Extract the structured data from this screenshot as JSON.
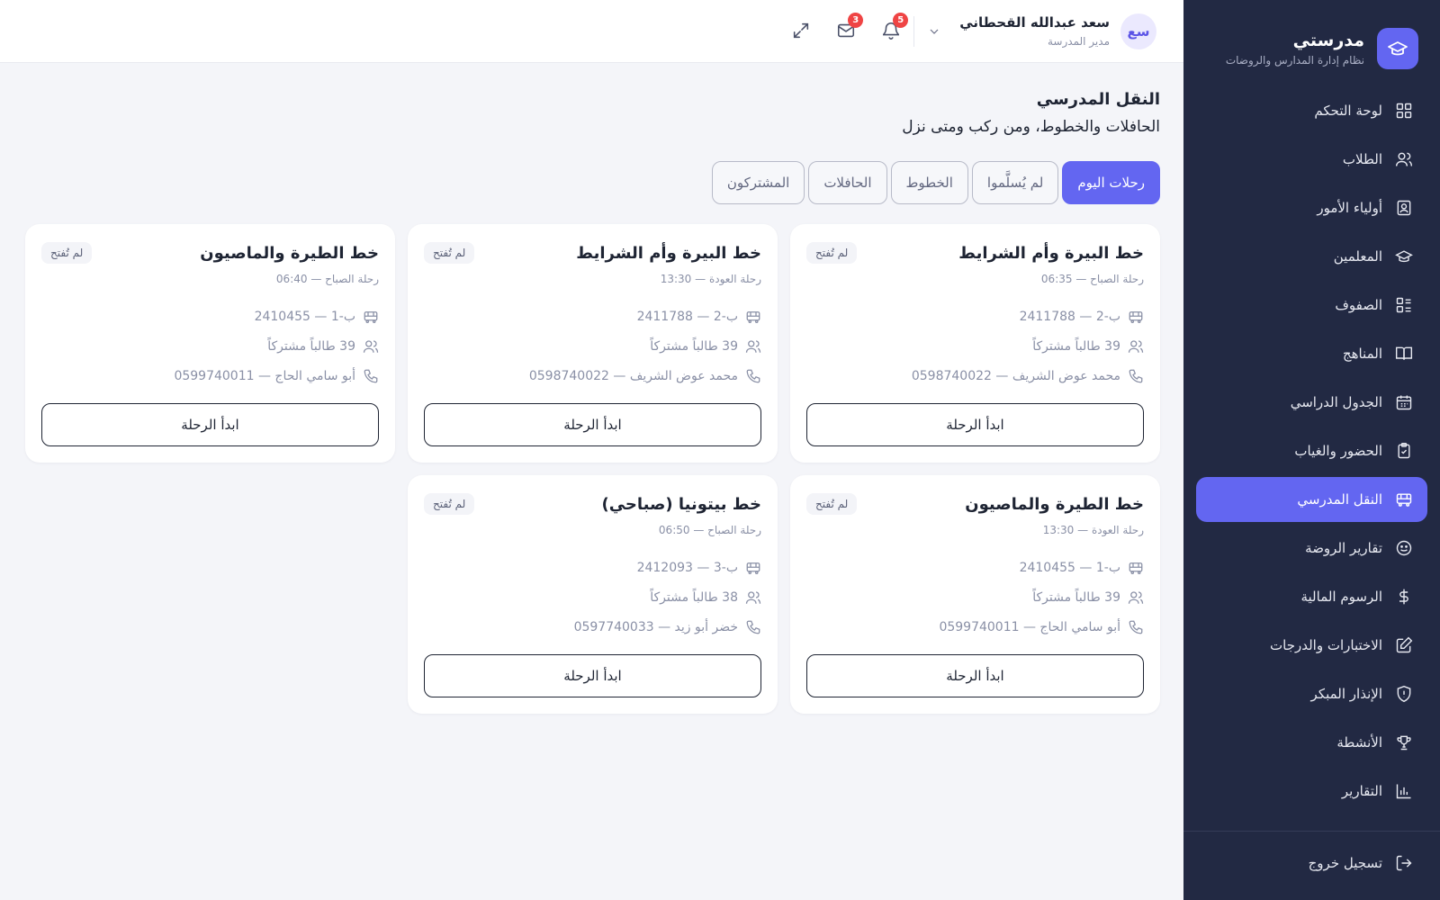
{
  "brand": {
    "name": "مدرستي",
    "subtitle": "نظام إدارة المدارس والروضات"
  },
  "sidebar": {
    "items": [
      {
        "label": "لوحة التحكم",
        "icon": "dashboard-icon"
      },
      {
        "label": "الطلاب",
        "icon": "users-icon"
      },
      {
        "label": "أولياء الأمور",
        "icon": "contact-icon"
      },
      {
        "label": "المعلمين",
        "icon": "graduation-cap-icon"
      },
      {
        "label": "الصفوف",
        "icon": "list-icon"
      },
      {
        "label": "المناهج",
        "icon": "book-icon"
      },
      {
        "label": "الجدول الدراسي",
        "icon": "calendar-icon"
      },
      {
        "label": "الحضور والغياب",
        "icon": "clipboard-check-icon"
      },
      {
        "label": "النقل المدرسي",
        "icon": "bus-icon",
        "active": true
      },
      {
        "label": "تقارير الروضة",
        "icon": "smile-icon"
      },
      {
        "label": "الرسوم المالية",
        "icon": "dollar-icon"
      },
      {
        "label": "الاختبارات والدرجات",
        "icon": "edit-icon"
      },
      {
        "label": "الإنذار المبكر",
        "icon": "shield-icon"
      },
      {
        "label": "الأنشطة",
        "icon": "trophy-icon"
      },
      {
        "label": "التقارير",
        "icon": "bar-chart-icon"
      }
    ],
    "logout": "تسجيل خروج"
  },
  "topbar": {
    "messages_badge": "3",
    "notifications_badge": "5",
    "user": {
      "name": "سعد عبدالله القحطاني",
      "role": "مدير المدرسة",
      "initials": "سع"
    }
  },
  "page": {
    "title": "النقل المدرسي",
    "subtitle": "الحافلات والخطوط، ومن ركب ومتى نزل"
  },
  "tabs": [
    "رحلات اليوم",
    "لم يُسلَّموا",
    "الخطوط",
    "الحافلات",
    "المشتركون"
  ],
  "trips": [
    {
      "title": "خط البيرة وأم الشرايط",
      "status": "لم تُفتح",
      "time": "رحلة الصباح — 06:35",
      "bus": "ب-2 — 2411788",
      "students": "39 طالباً مشتركاً",
      "driver": "محمد عوض الشريف — 0598740022",
      "action": "ابدأ الرحلة"
    },
    {
      "title": "خط البيرة وأم الشرايط",
      "status": "لم تُفتح",
      "time": "رحلة العودة — 13:30",
      "bus": "ب-2 — 2411788",
      "students": "39 طالباً مشتركاً",
      "driver": "محمد عوض الشريف — 0598740022",
      "action": "ابدأ الرحلة"
    },
    {
      "title": "خط الطيرة والماصيون",
      "status": "لم تُفتح",
      "time": "رحلة الصباح — 06:40",
      "bus": "ب-1 — 2410455",
      "students": "39 طالباً مشتركاً",
      "driver": "أبو سامي الحاج — 0599740011",
      "action": "ابدأ الرحلة"
    },
    {
      "title": "خط الطيرة والماصيون",
      "status": "لم تُفتح",
      "time": "رحلة العودة — 13:30",
      "bus": "ب-1 — 2410455",
      "students": "39 طالباً مشتركاً",
      "driver": "أبو سامي الحاج — 0599740011",
      "action": "ابدأ الرحلة"
    },
    {
      "title": "خط بيتونيا (صباحي)",
      "status": "لم تُفتح",
      "time": "رحلة الصباح — 06:50",
      "bus": "ب-3 — 2412093",
      "students": "38 طالباً مشتركاً",
      "driver": "خضر أبو زيد — 0597740033",
      "action": "ابدأ الرحلة"
    }
  ],
  "colors": {
    "accent": "#6366f1",
    "sidebar_bg": "#222943",
    "badge": "#ef4444"
  }
}
